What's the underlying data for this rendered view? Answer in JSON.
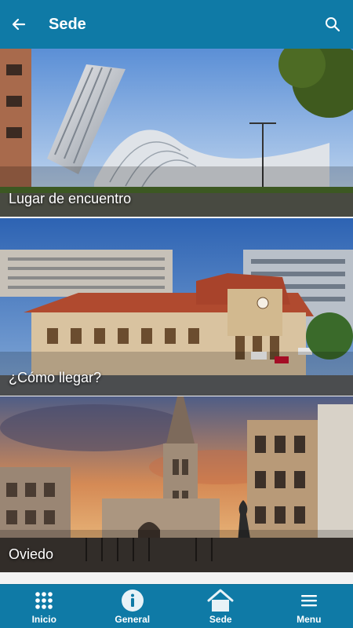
{
  "header": {
    "title": "Sede"
  },
  "cards": [
    {
      "label": "Lugar de encuentro"
    },
    {
      "label": "¿Cómo llegar?"
    },
    {
      "label": "Oviedo"
    }
  ],
  "nav": [
    {
      "label": "Inicio",
      "icon": "grid-icon"
    },
    {
      "label": "General",
      "icon": "info-icon"
    },
    {
      "label": "Sede",
      "icon": "home-icon"
    },
    {
      "label": "Menu",
      "icon": "hamburger-icon"
    }
  ],
  "colors": {
    "primary": "#0f7aa6"
  }
}
